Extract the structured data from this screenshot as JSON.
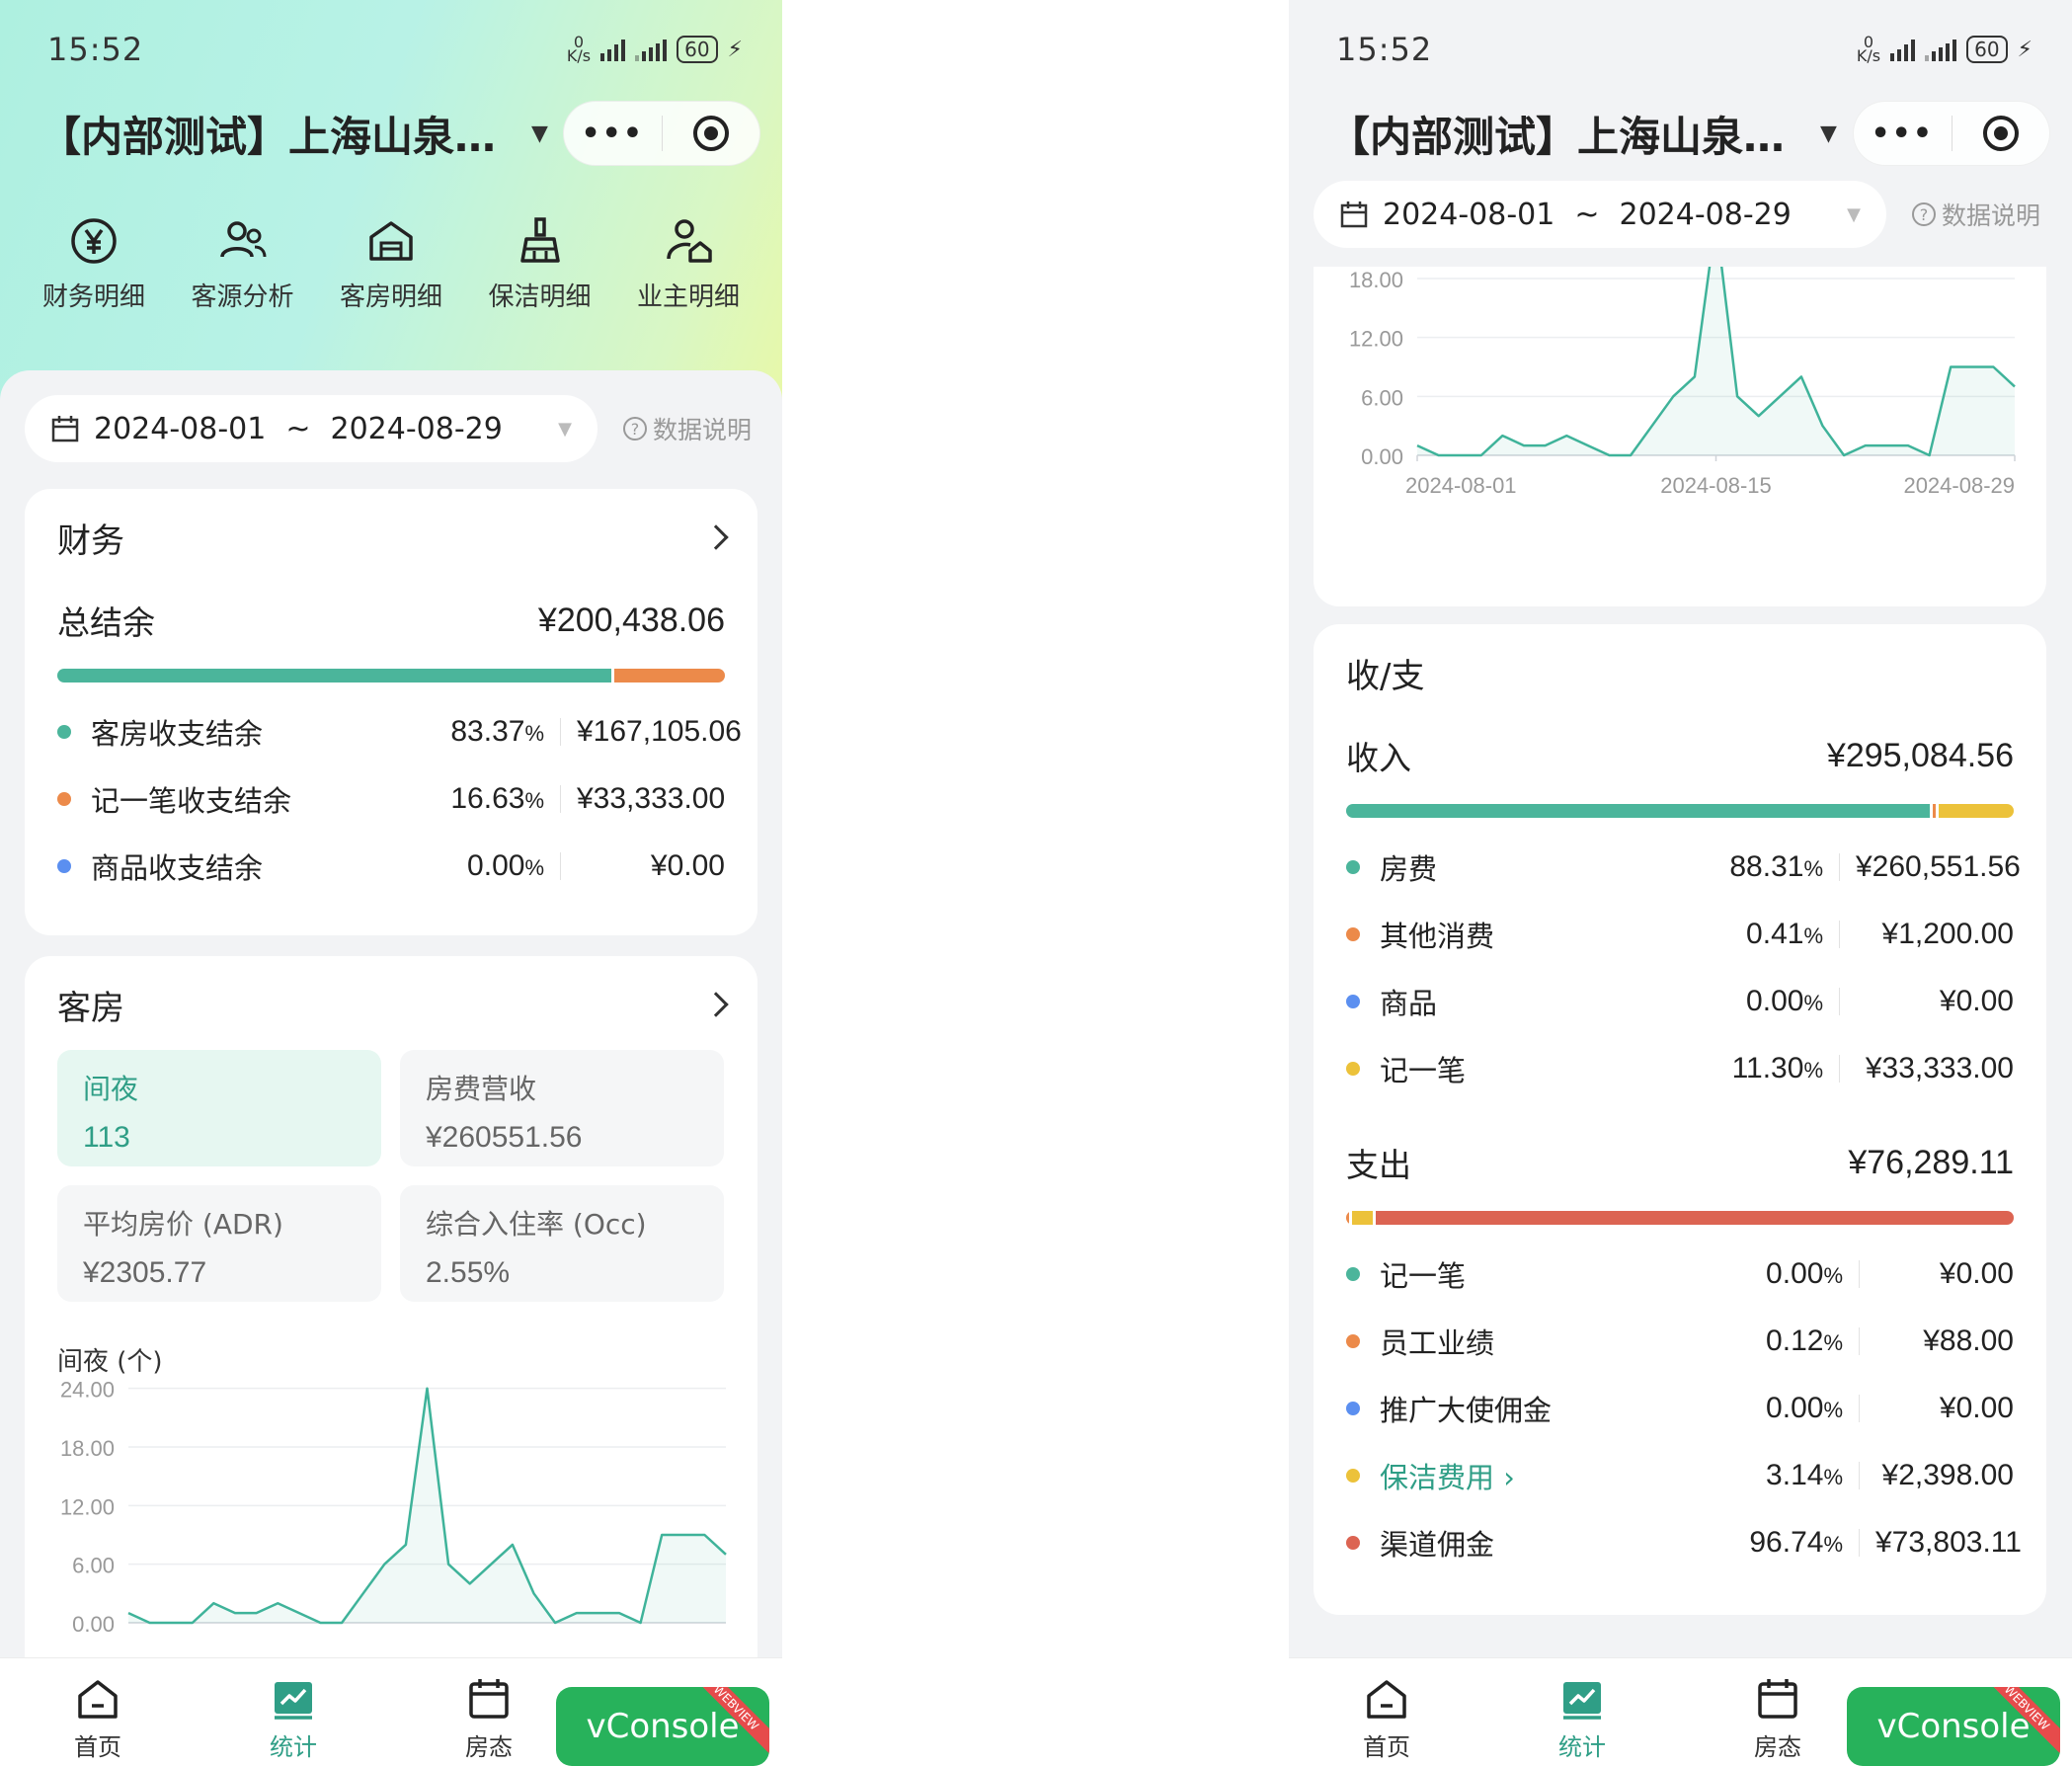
{
  "status": {
    "time": "15:52",
    "net_speed_top": "0",
    "net_speed_unit": "K/s",
    "battery": "60"
  },
  "header": {
    "title": "【内部测试】上海山泉…",
    "more_label": "•••"
  },
  "quicknav": [
    {
      "label": "财务明细",
      "icon": "yen-circle-icon"
    },
    {
      "label": "客源分析",
      "icon": "users-icon"
    },
    {
      "label": "客房明细",
      "icon": "house-icon"
    },
    {
      "label": "保洁明细",
      "icon": "broom-icon"
    },
    {
      "label": "业主明细",
      "icon": "owner-house-icon"
    }
  ],
  "daterange": {
    "start": "2024-08-01",
    "sep": "~",
    "end": "2024-08-29",
    "help": "数据说明"
  },
  "finance": {
    "title": "财务",
    "total_label": "总结余",
    "total_value": "¥200,438.06",
    "rows": [
      {
        "label": "客房收支结余",
        "pct": "83.37",
        "value": "¥167,105.06",
        "color": "#4bb59b"
      },
      {
        "label": "记一笔收支结余",
        "pct": "16.63",
        "value": "¥33,333.00",
        "color": "#ec8a4a"
      },
      {
        "label": "商品收支结余",
        "pct": "0.00",
        "value": "¥0.00",
        "color": "#5b8ff0"
      }
    ]
  },
  "rooms": {
    "title": "客房",
    "tiles": [
      {
        "label": "间夜",
        "value": "113",
        "active": true
      },
      {
        "label": "房费营收",
        "value": "¥260551.56",
        "active": false
      },
      {
        "label": "平均房价 (ADR)",
        "value": "¥2305.77",
        "active": false
      },
      {
        "label": "综合入住率 (Occ)",
        "value": "2.55%",
        "active": false
      }
    ],
    "chart_label": "间夜 (个)"
  },
  "chart_data": {
    "type": "area",
    "ylabel": "间夜 (个)",
    "y_ticks": [
      "0.00",
      "6.00",
      "12.00",
      "18.00",
      "24.00"
    ],
    "ylim": [
      0,
      24
    ],
    "x_ticks": [
      "2024-08-01",
      "2024-08-15",
      "2024-08-29"
    ],
    "x": [
      "2024-08-01",
      "2024-08-02",
      "2024-08-03",
      "2024-08-04",
      "2024-08-05",
      "2024-08-06",
      "2024-08-07",
      "2024-08-08",
      "2024-08-09",
      "2024-08-10",
      "2024-08-11",
      "2024-08-12",
      "2024-08-13",
      "2024-08-14",
      "2024-08-15",
      "2024-08-16",
      "2024-08-17",
      "2024-08-18",
      "2024-08-19",
      "2024-08-20",
      "2024-08-21",
      "2024-08-22",
      "2024-08-23",
      "2024-08-24",
      "2024-08-25",
      "2024-08-26",
      "2024-08-27",
      "2024-08-28",
      "2024-08-29"
    ],
    "series": [
      {
        "values": [
          1,
          0,
          0,
          0,
          2,
          1,
          1,
          2,
          1,
          0,
          0,
          3,
          6,
          8,
          24,
          6,
          4,
          6,
          8,
          3,
          0,
          1,
          1,
          1,
          0,
          9,
          9,
          9,
          7
        ]
      }
    ],
    "color": "#3fb39a",
    "grid": true
  },
  "income": {
    "title": "收/支",
    "total_label": "收入",
    "total_value": "¥295,084.56",
    "rows": [
      {
        "label": "房费",
        "pct": "88.31",
        "value": "¥260,551.56",
        "color": "#4bb59b"
      },
      {
        "label": "其他消费",
        "pct": "0.41",
        "value": "¥1,200.00",
        "color": "#ec8a4a"
      },
      {
        "label": "商品",
        "pct": "0.00",
        "value": "¥0.00",
        "color": "#5b8ff0"
      },
      {
        "label": "记一笔",
        "pct": "11.30",
        "value": "¥33,333.00",
        "color": "#ecc23a"
      }
    ]
  },
  "expense": {
    "total_label": "支出",
    "total_value": "¥76,289.11",
    "rows": [
      {
        "label": "记一笔",
        "pct": "0.00",
        "value": "¥0.00",
        "color": "#4bb59b",
        "link": false
      },
      {
        "label": "员工业绩",
        "pct": "0.12",
        "value": "¥88.00",
        "color": "#ec8a4a",
        "link": false
      },
      {
        "label": "推广大使佣金",
        "pct": "0.00",
        "value": "¥0.00",
        "color": "#5b8ff0",
        "link": false
      },
      {
        "label": "保洁费用 ›",
        "pct": "3.14",
        "value": "¥2,398.00",
        "color": "#ecc23a",
        "link": true
      },
      {
        "label": "渠道佣金",
        "pct": "96.74",
        "value": "¥73,803.11",
        "color": "#dc6452",
        "link": false
      }
    ]
  },
  "tabbar": [
    {
      "label": "首页",
      "icon": "home-icon",
      "active": false
    },
    {
      "label": "统计",
      "icon": "stats-icon",
      "active": true
    },
    {
      "label": "房态",
      "icon": "calendar-icon",
      "active": false
    }
  ],
  "vconsole": {
    "label": "vConsole",
    "badge": "WEBVIEW"
  }
}
